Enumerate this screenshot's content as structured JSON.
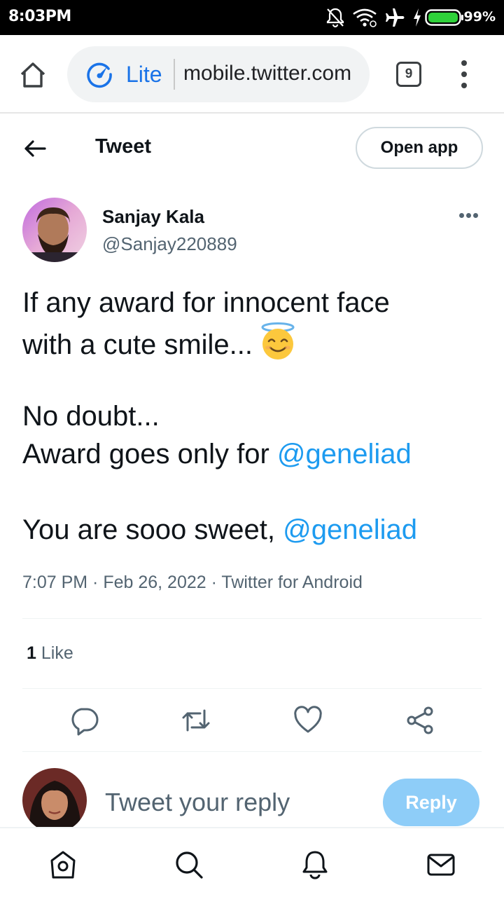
{
  "status_bar": {
    "time": "8:03PM",
    "battery": "99%",
    "icons": [
      "notifications-off-icon",
      "wifi-icon",
      "airplane-icon",
      "charging-icon",
      "battery-icon"
    ]
  },
  "browser": {
    "mode_label": "Lite",
    "url": "mobile.twitter.com",
    "tab_count": "9",
    "accent_color": "#1a73e8"
  },
  "header": {
    "title": "Tweet",
    "open_app_label": "Open app"
  },
  "tweet": {
    "author_name": "Sanjay Kala",
    "author_handle": "@Sanjay220889",
    "text": {
      "line1": "If any award for innocent face",
      "line2": "with a cute smile...",
      "line3": "No doubt...",
      "line4_prefix": "Award goes only for ",
      "line4_mention": "@geneliad",
      "line5_prefix": "You are sooo sweet, ",
      "line5_mention": "@geneliad"
    },
    "emoji": "smiling-face-with-halo",
    "meta": "7:07 PM · Feb 26, 2022 · Twitter for Android",
    "likes_count": "1",
    "likes_label": "Like",
    "mention_color": "#1d9bf0"
  },
  "actions": [
    "reply-icon",
    "retweet-icon",
    "like-icon",
    "share-icon"
  ],
  "reply": {
    "placeholder": "Tweet your reply",
    "button_label": "Reply"
  },
  "bottom_nav": [
    "home-icon",
    "search-icon",
    "notifications-icon",
    "messages-icon"
  ]
}
